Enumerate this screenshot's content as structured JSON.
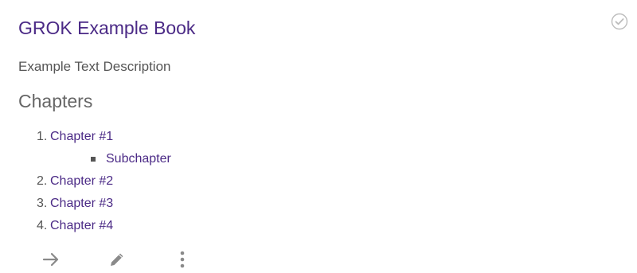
{
  "book": {
    "title": "GROK Example Book",
    "description": "Example Text Description",
    "completed_icon": "check-circle-icon"
  },
  "chapters": {
    "heading": "Chapters",
    "items": [
      {
        "number": "1.",
        "label": "Chapter #1",
        "subchapters": [
          {
            "label": "Subchapter"
          }
        ]
      },
      {
        "number": "2.",
        "label": "Chapter #2"
      },
      {
        "number": "3.",
        "label": "Chapter #3"
      },
      {
        "number": "4.",
        "label": "Chapter #4"
      }
    ]
  },
  "actions": [
    {
      "name": "open-arrow-icon",
      "icon": "arrow-right"
    },
    {
      "name": "edit-pencil-icon",
      "icon": "pencil"
    },
    {
      "name": "more-options-icon",
      "icon": "vertical-dots"
    }
  ],
  "colors": {
    "link": "#4b2a86",
    "text": "#555555",
    "heading": "#666666",
    "icon": "#9e9e9e"
  }
}
